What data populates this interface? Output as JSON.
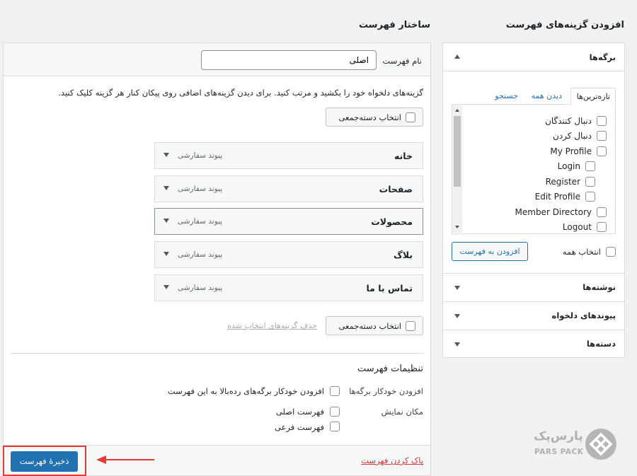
{
  "sidebar": {
    "title": "افزودن گزینه‌های فهرست",
    "pages_panel": {
      "title": "برگه‌ها",
      "tabs": [
        "تازه‌ترین‌ها",
        "دیدن همه",
        "جستجو"
      ],
      "items": [
        "دنبال کنندگان",
        "دنبال کردن",
        "My Profile",
        "Login",
        "Register",
        "Edit Profile",
        "Member Directory",
        "Logout"
      ],
      "select_all": "انتخاب همه",
      "add_button": "افزودن به فهرست"
    },
    "accordions": [
      "نوشته‌ها",
      "پیوندهای دلخواه",
      "دسته‌ها"
    ]
  },
  "main": {
    "title": "ساختار فهرست",
    "menu_name_label": "نام فهرست",
    "menu_name_value": "اصلی",
    "instructions": "گزینه‌های دلخواه خود را بکشید و مرتب کنید. برای دیدن گزینه‌های اضافی روی پیکان کنار هر گزینه کلیک کنید.",
    "bulk_select": "انتخاب دسته‌جمعی",
    "menu_items": [
      {
        "title": "خانه",
        "type": "پیوند سفارشی"
      },
      {
        "title": "صفحات",
        "type": "پیوند سفارشی"
      },
      {
        "title": "محصولات",
        "type": "پیوند سفارشی"
      },
      {
        "title": "بلاگ",
        "type": "پیوند سفارشی"
      },
      {
        "title": "تماس با ما",
        "type": "پیوند سفارشی"
      }
    ],
    "remove_selected": "حذف گزینه‌های انتخاب شده",
    "settings": {
      "title": "تنظیمات فهرست",
      "auto_add_label": "افزودن خودکار برگه‌ها",
      "auto_add_option": "افزودن خودکار برگه‌های رده‌بالا به این فهرست",
      "location_label": "مکان نمایش",
      "locations": [
        "فهرست اصلی",
        "فهرست فرعی"
      ]
    },
    "delete_link": "پاک کردن فهرست",
    "save_button": "ذخیرهٔ فهرست"
  },
  "brand": {
    "name_fa": "پارس‌پک",
    "name_en": "PARS PACK"
  },
  "colors": {
    "primary": "#2271b1",
    "danger": "#d63638",
    "highlight_red": "#e53935"
  }
}
